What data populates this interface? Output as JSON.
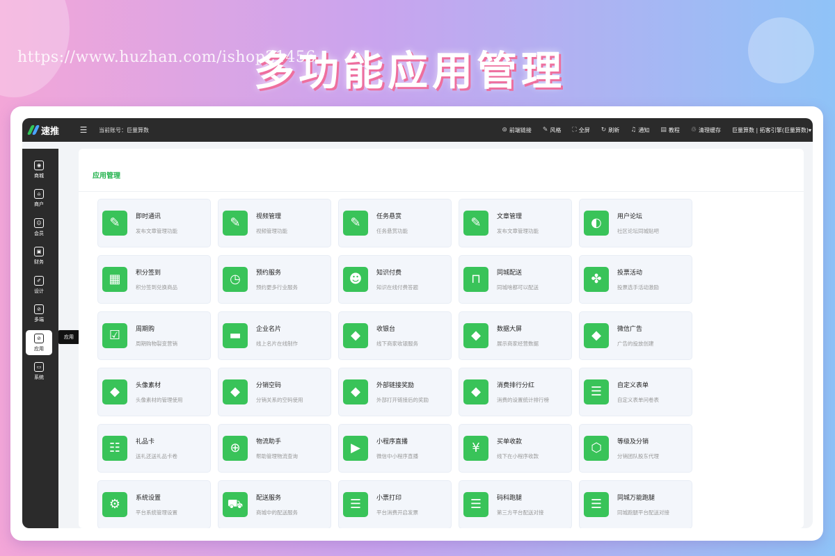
{
  "banner": {
    "title": "多功能应用管理",
    "watermark": "https://www.huzhan.com/ishop21456"
  },
  "topbar": {
    "logo_text": "速推",
    "menu_icon": "☰",
    "account_label": "当前账号：巨量算数",
    "tools": [
      {
        "icon": "link-icon",
        "glyph": "⊚",
        "label": "前端链接"
      },
      {
        "icon": "style-icon",
        "glyph": "✎",
        "label": "风格"
      },
      {
        "icon": "fullscreen-icon",
        "glyph": "⛶",
        "label": "全屏"
      },
      {
        "icon": "refresh-icon",
        "glyph": "↻",
        "label": "刷新"
      },
      {
        "icon": "bell-icon",
        "glyph": "♫",
        "label": "通知"
      },
      {
        "icon": "book-icon",
        "glyph": "▤",
        "label": "教程"
      },
      {
        "icon": "trash-icon",
        "glyph": "♲",
        "label": "清理缓存"
      }
    ],
    "user": "巨量算数 | 拓客引擎(巨量算数)▾"
  },
  "sidebar": {
    "items": [
      {
        "label": "商城",
        "icon": "mall-icon",
        "glyph": "◉"
      },
      {
        "label": "商户",
        "icon": "merchant-icon",
        "glyph": "⌂"
      },
      {
        "label": "会员",
        "icon": "member-icon",
        "glyph": "☺"
      },
      {
        "label": "财务",
        "icon": "finance-icon",
        "glyph": "▣"
      },
      {
        "label": "设计",
        "icon": "design-icon",
        "glyph": "✐"
      },
      {
        "label": "多端",
        "icon": "multi-end-icon",
        "glyph": "⊘"
      },
      {
        "label": "应用",
        "icon": "apps-icon",
        "glyph": "⊘",
        "active": true
      },
      {
        "label": "系统",
        "icon": "system-icon",
        "glyph": "▭"
      }
    ],
    "tooltip": "应用"
  },
  "main": {
    "title": "应用管理",
    "apps": [
      {
        "name": "即时通讯",
        "desc": "发布文章管理功能",
        "icon": "pen-icon",
        "glyph": "✎"
      },
      {
        "name": "视频管理",
        "desc": "视频管理功能",
        "icon": "pen-icon",
        "glyph": "✎"
      },
      {
        "name": "任务悬赏",
        "desc": "任务悬赏功能",
        "icon": "pen-icon",
        "glyph": "✎"
      },
      {
        "name": "文章管理",
        "desc": "发布文章管理功能",
        "icon": "pen-icon",
        "glyph": "✎"
      },
      {
        "name": "用户论坛",
        "desc": "社区论坛同城贴吧",
        "icon": "planet-icon",
        "glyph": "◐"
      },
      {
        "name": "积分签到",
        "desc": "积分签到兑换商品",
        "icon": "calendar-icon",
        "glyph": "▦"
      },
      {
        "name": "预约服务",
        "desc": "预约更多行业服务",
        "icon": "alarm-clock-icon",
        "glyph": "◷"
      },
      {
        "name": "知识付费",
        "desc": "知识在线付费答题",
        "icon": "person-card-icon",
        "glyph": "☻"
      },
      {
        "name": "同城配送",
        "desc": "同城啥都可以配送",
        "icon": "shopping-bag-icon",
        "glyph": "⊓"
      },
      {
        "name": "投票活动",
        "desc": "投票选手活动激励",
        "icon": "clover-icon",
        "glyph": "✤"
      },
      {
        "name": "周期购",
        "desc": "周期购物裂变营销",
        "icon": "bag-check-icon",
        "glyph": "☑"
      },
      {
        "name": "企业名片",
        "desc": "线上名片在线制作",
        "icon": "business-card-icon",
        "glyph": "▬"
      },
      {
        "name": "收银台",
        "desc": "线下商家收银服务",
        "icon": "diamond-icon",
        "glyph": "◆"
      },
      {
        "name": "数据大屏",
        "desc": "展示商家经营数据",
        "icon": "diamond-icon",
        "glyph": "◆"
      },
      {
        "name": "微信广告",
        "desc": "广告的投放创建",
        "icon": "diamond-icon",
        "glyph": "◆"
      },
      {
        "name": "头像素材",
        "desc": "头像素材的管理使用",
        "icon": "diamond-icon",
        "glyph": "◆"
      },
      {
        "name": "分销空码",
        "desc": "分销关系的空码使用",
        "icon": "diamond-icon",
        "glyph": "◆"
      },
      {
        "name": "外部链接奖励",
        "desc": "外部打开链接后的奖励",
        "icon": "diamond-icon",
        "glyph": "◆"
      },
      {
        "name": "消费排行分红",
        "desc": "消费的设置统计排行榜",
        "icon": "diamond-icon",
        "glyph": "◆"
      },
      {
        "name": "自定义表单",
        "desc": "自定义表单问卷表",
        "icon": "form-icon",
        "glyph": "☰"
      },
      {
        "name": "礼品卡",
        "desc": "送礼还送礼品卡卷",
        "icon": "gift-card-icon",
        "glyph": "☷"
      },
      {
        "name": "物流助手",
        "desc": "帮助管理物流查询",
        "icon": "logistics-icon",
        "glyph": "⊕"
      },
      {
        "name": "小程序直播",
        "desc": "微信中小程序直播",
        "icon": "tv-play-icon",
        "glyph": "▶"
      },
      {
        "name": "买单收款",
        "desc": "线下在小程序收款",
        "icon": "yen-phone-icon",
        "glyph": "¥"
      },
      {
        "name": "等级及分销",
        "desc": "分销团队股东代理",
        "icon": "hexagon-icon",
        "glyph": "⬡"
      },
      {
        "name": "系统设置",
        "desc": "平台系统管理设置",
        "icon": "store-settings-icon",
        "glyph": "⚙"
      },
      {
        "name": "配送服务",
        "desc": "商城中的配送服务",
        "icon": "scooter-icon",
        "glyph": "⛟"
      },
      {
        "name": "小票打印",
        "desc": "平台消费开启发票",
        "icon": "receipt-icon",
        "glyph": "☰"
      },
      {
        "name": "码科跑腿",
        "desc": "第三方平台配送对接",
        "icon": "receipt-icon",
        "glyph": "☰"
      },
      {
        "name": "同城万能跑腿",
        "desc": "同城跑腿平台配送对接",
        "icon": "receipt-icon",
        "glyph": "☰"
      }
    ]
  },
  "colors": {
    "accent": "#39c359",
    "title_green": "#22b24c",
    "topbar": "#2b2b2b"
  }
}
